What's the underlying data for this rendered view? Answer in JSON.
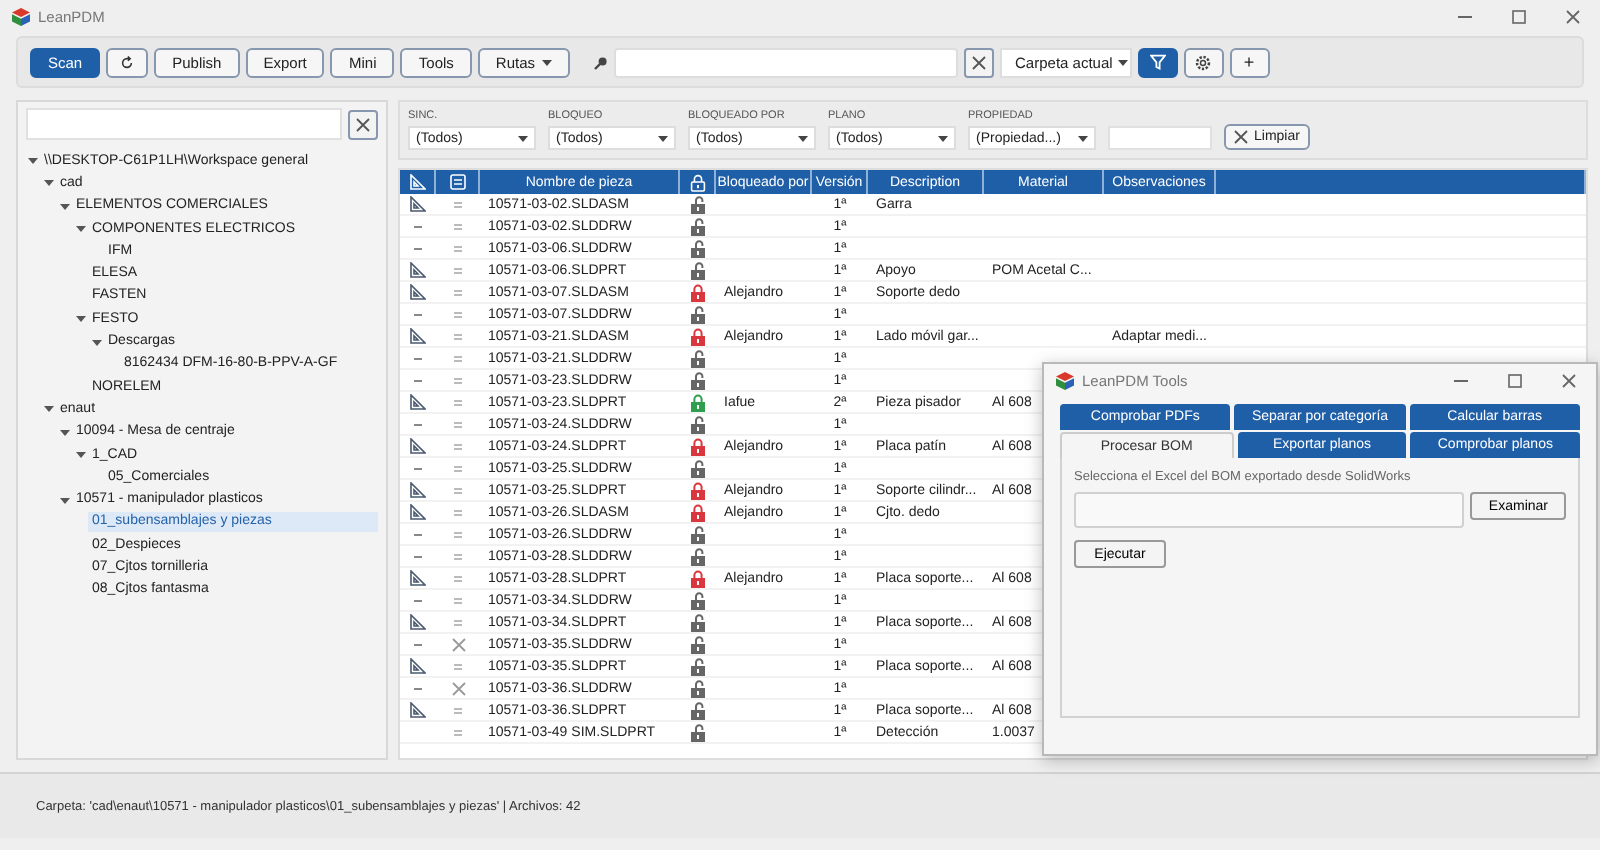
{
  "window": {
    "title": "LeanPDM"
  },
  "toolbar": {
    "buttons": [
      {
        "kind": "primary",
        "label": "Scan"
      },
      {
        "kind": "refresh"
      },
      {
        "kind": "text",
        "label": "Publish"
      },
      {
        "kind": "text",
        "label": "Export"
      },
      {
        "kind": "text",
        "label": "Mini"
      },
      {
        "kind": "text",
        "label": "Tools"
      },
      {
        "kind": "menu",
        "label": "Rutas"
      }
    ],
    "scope": "Carpeta actual",
    "toggles": [
      {
        "kind": "filter",
        "on": true
      },
      {
        "kind": "settings",
        "on": false
      },
      {
        "kind": "text",
        "label": "+",
        "on": false
      }
    ]
  },
  "tree": [
    {
      "label": "\\\\DESKTOP-C61P1LH\\Workspace general",
      "expanded": true,
      "selected": false,
      "children": [
        {
          "label": "cad",
          "expanded": true,
          "selected": false,
          "children": [
            {
              "label": "ELEMENTOS COMERCIALES",
              "expanded": true,
              "selected": false,
              "children": [
                {
                  "label": "COMPONENTES ELECTRICOS",
                  "expanded": true,
                  "selected": false,
                  "children": [
                    {
                      "label": "IFM",
                      "selected": false
                    }
                  ]
                },
                {
                  "label": "ELESA",
                  "selected": false
                },
                {
                  "label": "FASTEN",
                  "selected": false
                },
                {
                  "label": "FESTO",
                  "expanded": true,
                  "selected": false,
                  "children": [
                    {
                      "label": "Descargas",
                      "expanded": true,
                      "selected": false,
                      "children": [
                        {
                          "label": "8162434 DFM-16-80-B-PPV-A-GF",
                          "selected": false
                        }
                      ]
                    }
                  ]
                },
                {
                  "label": "NORELEM",
                  "selected": false
                }
              ]
            }
          ]
        },
        {
          "label": "enaut",
          "expanded": true,
          "selected": false,
          "children": [
            {
              "label": "10094 - Mesa de centraje",
              "expanded": true,
              "selected": false,
              "children": [
                {
                  "label": "1_CAD",
                  "expanded": true,
                  "selected": false,
                  "children": [
                    {
                      "label": "05_Comerciales",
                      "selected": false
                    }
                  ]
                }
              ]
            },
            {
              "label": "10571 - manipulador plasticos",
              "expanded": true,
              "selected": false,
              "children": [
                {
                  "label": "01_subensamblajes y piezas",
                  "selected": true
                },
                {
                  "label": "02_Despieces",
                  "selected": false
                },
                {
                  "label": "07_Cjtos tornilleria",
                  "selected": false
                },
                {
                  "label": "08_Cjtos fantasma",
                  "selected": false
                }
              ]
            }
          ]
        }
      ]
    }
  ],
  "filters": [
    {
      "label": "SINC.",
      "value": "(Todos)"
    },
    {
      "label": "BLOQUEO",
      "value": "(Todos)"
    },
    {
      "label": "BLOQUEADO POR",
      "value": "(Todos)"
    },
    {
      "label": "PLANO",
      "value": "(Todos)"
    },
    {
      "label": "PROPIEDAD",
      "value": "(Propiedad...)"
    }
  ],
  "clear_filters": "Limpiar",
  "table": {
    "columns": [
      "Nombre de pieza",
      "Bloqueado por",
      "Versión",
      "Description",
      "Material",
      "Observaciones"
    ],
    "rows": [
      {
        "kind": "model",
        "synced": true,
        "name": "10571-03-02.SLDASM",
        "locked": false,
        "color": "#666666",
        "version": "1ª",
        "description": "Garra"
      },
      {
        "kind": "drawing",
        "synced": true,
        "name": "10571-03-02.SLDDRW",
        "locked": false,
        "color": "#666666",
        "version": "1ª"
      },
      {
        "kind": "drawing",
        "synced": true,
        "name": "10571-03-06.SLDDRW",
        "locked": false,
        "color": "#666666",
        "version": "1ª"
      },
      {
        "kind": "model",
        "synced": true,
        "name": "10571-03-06.SLDPRT",
        "locked": false,
        "color": "#666666",
        "version": "1ª",
        "description": "Apoyo",
        "material": "POM Acetal C..."
      },
      {
        "kind": "model",
        "synced": true,
        "name": "10571-03-07.SLDASM",
        "locked": true,
        "color": "#d9363e",
        "locked_by": "Alejandro",
        "version": "1ª",
        "description": "Soporte dedo"
      },
      {
        "kind": "drawing",
        "synced": true,
        "name": "10571-03-07.SLDDRW",
        "locked": false,
        "color": "#666666",
        "version": "1ª"
      },
      {
        "kind": "model",
        "synced": true,
        "name": "10571-03-21.SLDASM",
        "locked": true,
        "color": "#d9363e",
        "locked_by": "Alejandro",
        "version": "1ª",
        "description": "Lado móvil gar...",
        "notes": "Adaptar medi..."
      },
      {
        "kind": "drawing",
        "synced": true,
        "name": "10571-03-21.SLDDRW",
        "locked": false,
        "color": "#666666",
        "version": "1ª"
      },
      {
        "kind": "drawing",
        "synced": true,
        "name": "10571-03-23.SLDDRW",
        "locked": false,
        "color": "#666666",
        "version": "1ª"
      },
      {
        "kind": "model",
        "synced": true,
        "name": "10571-03-23.SLDPRT",
        "locked": true,
        "color": "#2e9e4f",
        "locked_by": "Iafue",
        "version": "2ª",
        "description": "Pieza pisador",
        "material": "Al 608"
      },
      {
        "kind": "drawing",
        "synced": true,
        "name": "10571-03-24.SLDDRW",
        "locked": false,
        "color": "#666666",
        "version": "1ª"
      },
      {
        "kind": "model",
        "synced": true,
        "name": "10571-03-24.SLDPRT",
        "locked": true,
        "color": "#d9363e",
        "locked_by": "Alejandro",
        "version": "1ª",
        "description": "Placa patín",
        "material": "Al 608"
      },
      {
        "kind": "drawing",
        "synced": true,
        "name": "10571-03-25.SLDDRW",
        "locked": false,
        "color": "#666666",
        "version": "1ª"
      },
      {
        "kind": "model",
        "synced": true,
        "name": "10571-03-25.SLDPRT",
        "locked": true,
        "color": "#d9363e",
        "locked_by": "Alejandro",
        "version": "1ª",
        "description": "Soporte cilindr...",
        "material": "Al 608"
      },
      {
        "kind": "model",
        "synced": true,
        "name": "10571-03-26.SLDASM",
        "locked": true,
        "color": "#d9363e",
        "locked_by": "Alejandro",
        "version": "1ª",
        "description": "Cjto. dedo"
      },
      {
        "kind": "drawing",
        "synced": true,
        "name": "10571-03-26.SLDDRW",
        "locked": false,
        "color": "#666666",
        "version": "1ª"
      },
      {
        "kind": "drawing",
        "synced": true,
        "name": "10571-03-28.SLDDRW",
        "locked": false,
        "color": "#666666",
        "version": "1ª"
      },
      {
        "kind": "model",
        "synced": true,
        "name": "10571-03-28.SLDPRT",
        "locked": true,
        "color": "#d9363e",
        "locked_by": "Alejandro",
        "version": "1ª",
        "description": "Placa soporte...",
        "material": "Al 608"
      },
      {
        "kind": "drawing",
        "synced": true,
        "name": "10571-03-34.SLDDRW",
        "locked": false,
        "color": "#666666",
        "version": "1ª"
      },
      {
        "kind": "model",
        "synced": true,
        "name": "10571-03-34.SLDPRT",
        "locked": false,
        "color": "#666666",
        "version": "1ª",
        "description": "Placa soporte...",
        "material": "Al 608"
      },
      {
        "kind": "drawing",
        "synced": false,
        "name": "10571-03-35.SLDDRW",
        "locked": false,
        "color": "#666666",
        "version": "1ª"
      },
      {
        "kind": "model",
        "synced": true,
        "name": "10571-03-35.SLDPRT",
        "locked": false,
        "color": "#666666",
        "version": "1ª",
        "description": "Placa soporte...",
        "material": "Al 608"
      },
      {
        "kind": "drawing",
        "synced": false,
        "name": "10571-03-36.SLDDRW",
        "locked": false,
        "color": "#666666",
        "version": "1ª"
      },
      {
        "kind": "model",
        "synced": true,
        "name": "10571-03-36.SLDPRT",
        "locked": false,
        "color": "#666666",
        "version": "1ª",
        "description": "Placa soporte...",
        "material": "Al 608"
      },
      {
        "kind": "other",
        "synced": true,
        "name": "10571-03-49 SIM.SLDPRT",
        "locked": false,
        "color": "#666666",
        "version": "1ª",
        "description": "Detección",
        "material": "1.0037"
      }
    ]
  },
  "status_bar": "Carpeta: 'cad\\enaut\\10571 - manipulador plasticos\\01_subensamblajes y piezas' | Archivos: 42",
  "tools_window": {
    "title": "LeanPDM Tools",
    "tab_rows": [
      {
        "tabs": [
          {
            "label": "Comprobar PDFs",
            "selected": false
          },
          {
            "label": "Separar por categoría",
            "selected": false
          },
          {
            "label": "Calcular barras",
            "selected": false
          }
        ]
      },
      {
        "tabs": [
          {
            "label": "Procesar BOM",
            "selected": true
          },
          {
            "label": "Exportar planos",
            "selected": false
          },
          {
            "label": "Comprobar planos",
            "selected": false
          }
        ]
      }
    ],
    "prompt": "Selecciona el Excel del BOM exportado desde SolidWorks",
    "browse_button": "Examinar",
    "run_button": "Ejecutar"
  }
}
